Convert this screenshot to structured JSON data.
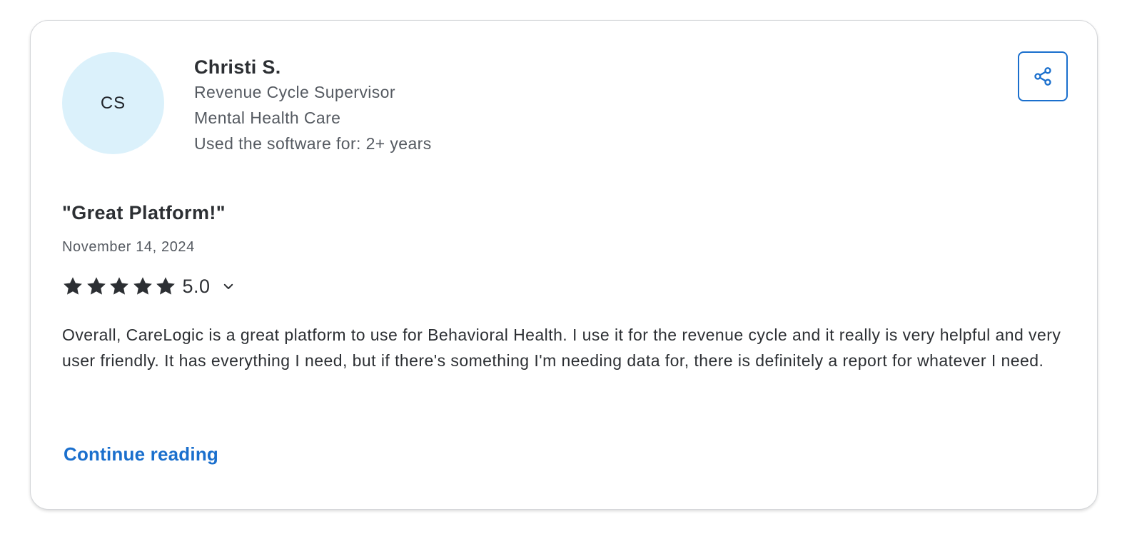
{
  "reviewer": {
    "initials": "CS",
    "name": "Christi S.",
    "role": "Revenue Cycle Supervisor",
    "industry": "Mental Health Care",
    "usage": "Used the software for: 2+ years"
  },
  "share": {
    "icon": "share-icon",
    "accent_color": "#1a6fcd"
  },
  "review": {
    "title": "\"Great Platform!\"",
    "date": "November 14, 2024",
    "rating": {
      "value": 5,
      "max": 5,
      "label": "5.0",
      "toggle_icon": "chevron-down-icon"
    },
    "body": "Overall, CareLogic is a great platform to use for Behavioral Health. I use it for the revenue cycle and it really is very helpful and very user friendly. It has everything I need, but if there's something I'm needing data for, there is definitely a report for whatever I need.",
    "continue_label": "Continue reading"
  },
  "colors": {
    "avatar_bg": "#dbf1fb",
    "link": "#1a6fcd",
    "star": "#2c2f33"
  }
}
